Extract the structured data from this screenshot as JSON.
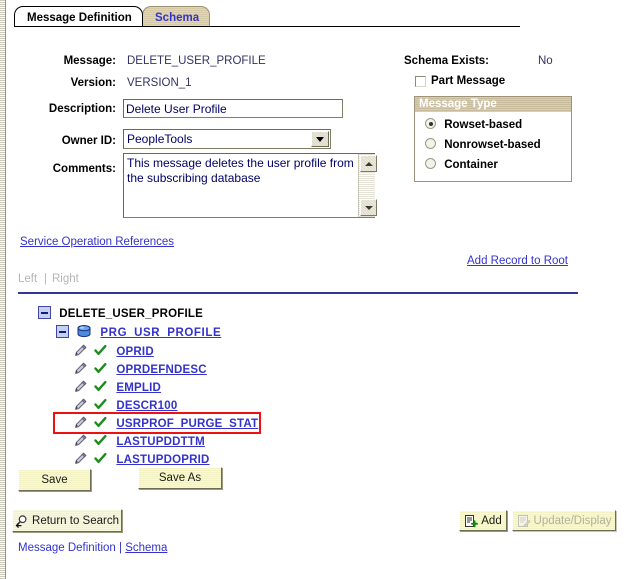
{
  "tabs": [
    {
      "label": "Message Definition",
      "active": true
    },
    {
      "label": "Schema",
      "active": false
    }
  ],
  "form": {
    "message_label": "Message:",
    "message_value": "DELETE_USER_PROFILE",
    "version_label": "Version:",
    "version_value": "VERSION_1",
    "description_label": "Description:",
    "description_value": "Delete User Profile",
    "owner_label": "Owner ID:",
    "owner_value": "PeopleTools",
    "comments_label": "Comments:",
    "comments_value": "This message deletes the user profile from the subscribing database"
  },
  "right_panel": {
    "schema_exists_label": "Schema Exists:",
    "schema_exists_value": "No",
    "part_message_label": "Part Message",
    "part_message_checked": false,
    "message_type": {
      "title": "Message Type",
      "options": [
        {
          "label": "Rowset-based",
          "selected": true
        },
        {
          "label": "Nonrowset-based",
          "selected": false
        },
        {
          "label": "Container",
          "selected": false
        }
      ]
    }
  },
  "links": {
    "service_operation_references": "Service Operation References",
    "add_record_to_root": "Add Record to Root",
    "left": "Left",
    "separator": "|",
    "right": "Right"
  },
  "tree": {
    "root": {
      "label": "DELETE_USER_PROFILE",
      "icon": "collapse-icon"
    },
    "record": {
      "label": "PRG_USR_PROFILE",
      "icon": "database-icon"
    },
    "fields": [
      {
        "label": "OPRID",
        "highlighted": false
      },
      {
        "label": "OPRDEFNDESC",
        "highlighted": false
      },
      {
        "label": "EMPLID",
        "highlighted": false
      },
      {
        "label": "DESCR100",
        "highlighted": false
      },
      {
        "label": "USRPROF_PURGE_STAT",
        "highlighted": true
      },
      {
        "label": "LASTUPDDTTM",
        "highlighted": false
      },
      {
        "label": "LASTUPDOPRID",
        "highlighted": false
      }
    ],
    "field_icons": [
      "pencil-icon",
      "checkmark-icon"
    ],
    "highlight_color": "#ee1111"
  },
  "buttons": {
    "save": "Save",
    "save_as": "Save As",
    "return_to_search": "Return to Search",
    "add": "Add",
    "update_display": "Update/Display",
    "update_display_disabled": true
  },
  "footer": {
    "current_page": "Message Definition",
    "separator": "|",
    "schema_link": "Schema"
  },
  "colors": {
    "link": "#3333cc",
    "tab_inactive": "#d6c9a8",
    "group_header": "#c9bc9c",
    "button_face": "#f2f2c4",
    "rule": "#333399",
    "highlight": "#ee1111"
  }
}
